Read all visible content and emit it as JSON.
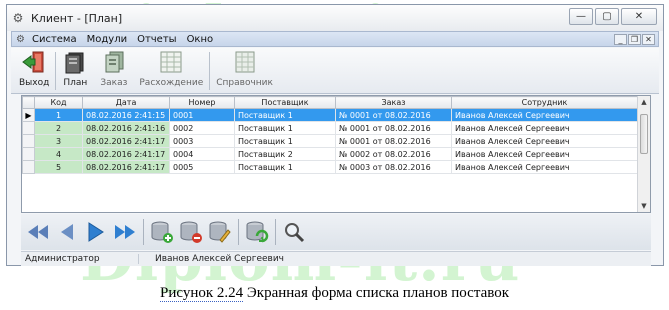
{
  "window": {
    "title": "Клиент - [План]"
  },
  "menu": {
    "items": [
      "Система",
      "Модули",
      "Отчеты",
      "Окно"
    ]
  },
  "toolbar": {
    "exit": "Выход",
    "plan": "План",
    "order": "Заказ",
    "discrepancy": "Расхождение",
    "reference": "Справочник"
  },
  "grid": {
    "columns": [
      "Код",
      "Дата",
      "Номер",
      "Поставщик",
      "Заказ",
      "Сотрудник"
    ],
    "rows": [
      {
        "code": "1",
        "date": "08.02.2016 2:41:15",
        "number": "0001",
        "supplier": "Поставщик 1",
        "order": "№ 0001 от 08.02.2016",
        "employee": "Иванов Алексей Сергеевич"
      },
      {
        "code": "2",
        "date": "08.02.2016 2:41:16",
        "number": "0002",
        "supplier": "Поставщик 1",
        "order": "№ 0001 от 08.02.2016",
        "employee": "Иванов Алексей Сергеевич"
      },
      {
        "code": "3",
        "date": "08.02.2016 2:41:17",
        "number": "0003",
        "supplier": "Поставщик 1",
        "order": "№ 0001 от 08.02.2016",
        "employee": "Иванов Алексей Сергеевич"
      },
      {
        "code": "4",
        "date": "08.02.2016 2:41:17",
        "number": "0004",
        "supplier": "Поставщик 2",
        "order": "№ 0002 от 08.02.2016",
        "employee": "Иванов Алексей Сергеевич"
      },
      {
        "code": "5",
        "date": "08.02.2016 2:41:17",
        "number": "0005",
        "supplier": "Поставщик 1",
        "order": "№ 0003 от 08.02.2016",
        "employee": "Иванов Алексей Сергеевич"
      }
    ]
  },
  "status": {
    "role": "Администратор",
    "user": "Иванов Алексей Сергеевич"
  },
  "caption": {
    "prefix": "Рисунок 2.24",
    "text": "Экранная форма списка планов поставок"
  },
  "watermark": "Diplom-it.ru",
  "colors": {
    "selection": "#3399ee",
    "code_column": "#c6e8c6",
    "watermark": "#9ee89a"
  }
}
